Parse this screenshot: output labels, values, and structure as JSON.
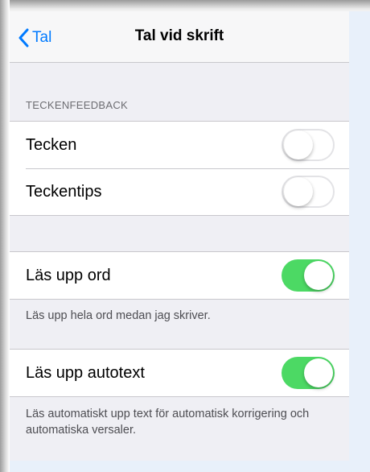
{
  "navbar": {
    "back_label": "Tal",
    "title": "Tal vid skrift"
  },
  "sections": {
    "teckenfeedback": {
      "header": "TECKENFEEDBACK",
      "rows": [
        {
          "label": "Tecken",
          "toggle": "off"
        },
        {
          "label": "Teckentips",
          "toggle": "off"
        }
      ]
    },
    "las_upp_ord": {
      "label": "Läs upp ord",
      "toggle": "on",
      "footer": "Läs upp hela ord medan jag skriver."
    },
    "las_upp_autotext": {
      "label": "Läs upp autotext",
      "toggle": "on",
      "footer": "Läs automatiskt upp text för automatisk korrigering och automatiska versaler."
    }
  },
  "colors": {
    "accent": "#007aff",
    "toggle_on": "#4cd964",
    "background": "#efeff4"
  },
  "icons": {
    "back": "chevron-left-icon"
  }
}
